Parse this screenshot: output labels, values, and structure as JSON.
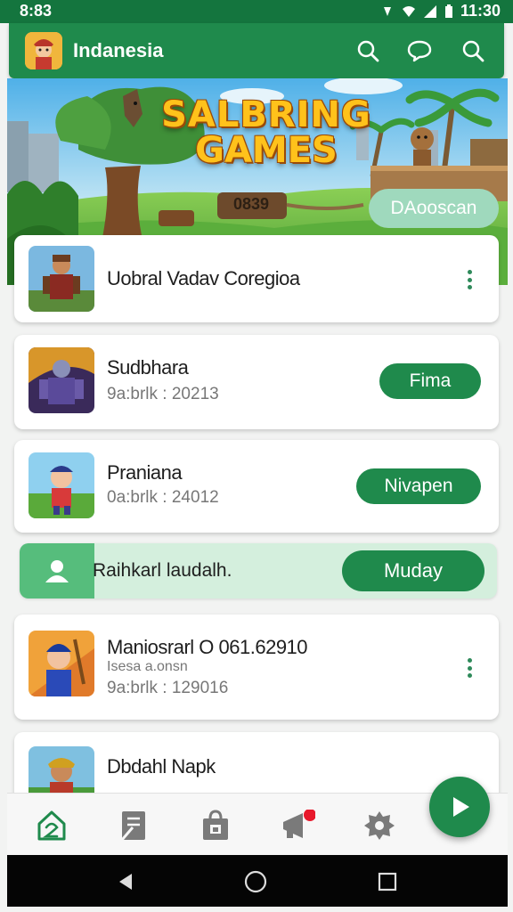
{
  "status_bar": {
    "time_left": "8:83",
    "time_right": "11:30"
  },
  "header": {
    "title": "Indanesia",
    "icons": [
      "search-icon",
      "chat-icon",
      "search-icon"
    ]
  },
  "banner": {
    "title_line1": "SALBRING",
    "title_line2": "GAMES",
    "sign_text": "0839",
    "button_label": "DAooscan"
  },
  "cards": [
    {
      "title": "Uobral Vadav Coregioa",
      "subtitle": "",
      "action": "menu"
    },
    {
      "title": "Sudbhara",
      "subtitle": "9a:brlk : 20213",
      "button": "Fima"
    },
    {
      "title": "Praniana",
      "subtitle": "0a:brlk : 24012",
      "button": "Nivapen"
    },
    {
      "title": "Maniosrarl O 061.62910",
      "subtitle": "Isesa a.onsn",
      "subtitle2": "9a:brlk : 129016",
      "action": "menu"
    },
    {
      "title": "Dbdahl Napk",
      "subtitle": "",
      "action": "menu"
    }
  ],
  "promo": {
    "text": "Raihkarl laudalh.",
    "button": "Muday"
  },
  "bottom_nav": {
    "items": [
      "home-icon",
      "document-icon",
      "bag-icon",
      "megaphone-icon",
      "settings-icon"
    ],
    "active": "home-icon",
    "notification_dot_color": "#e8192c"
  },
  "colors": {
    "primary": "#1f8a4c",
    "primary_dark": "#14753e",
    "accent_light": "#9fd9bd",
    "promo_bg": "#d4efdd"
  }
}
